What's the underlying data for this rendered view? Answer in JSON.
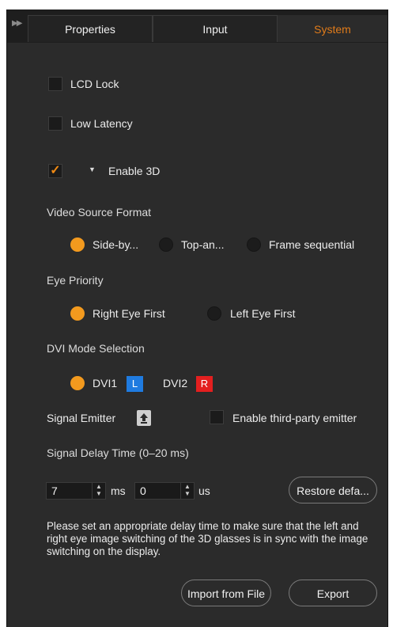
{
  "tabs": [
    {
      "label": "Properties",
      "active": false
    },
    {
      "label": "Input",
      "active": false
    },
    {
      "label": "System",
      "active": true
    }
  ],
  "colors": {
    "accent": "#f39a1e",
    "active_tab": "#e07b1a",
    "background": "#2b2b2b",
    "tag_left": "#1f7be0",
    "tag_right": "#e31f1f"
  },
  "options": {
    "lcd_lock": {
      "label": "LCD Lock",
      "checked": false
    },
    "low_latency": {
      "label": "Low Latency",
      "checked": false
    },
    "enable_3d": {
      "label": "Enable 3D",
      "checked": true,
      "check_glyph": "✓",
      "expand_glyph": "▼"
    }
  },
  "video_source_format": {
    "title": "Video Source Format",
    "options": [
      "Side-by...",
      "Top-an...",
      "Frame sequential"
    ],
    "selected": "Side-by..."
  },
  "eye_priority": {
    "title": "Eye Priority",
    "options": [
      "Right Eye First",
      "Left Eye First"
    ],
    "selected": "Right Eye First"
  },
  "dvi_mode": {
    "title": "DVI Mode Selection",
    "dvi1_label": "DVI1",
    "dvi1_tag": "L",
    "dvi2_label": "DVI2",
    "dvi2_tag": "R",
    "selected": "DVI1"
  },
  "signal_emitter": {
    "label": "Signal Emitter",
    "icon": "upload-icon",
    "third_party_label": "Enable third-party emitter",
    "third_party_checked": false
  },
  "signal_delay": {
    "title": "Signal Delay Time (0–20 ms)",
    "ms_value": "7",
    "ms_unit": "ms",
    "us_value": "0",
    "us_unit": "us",
    "restore_label": "Restore defa..."
  },
  "note": "Please set an appropriate delay time to make sure that the left and right eye image switching of the 3D glasses is in sync with the image switching on the display.",
  "footer": {
    "import_label": "Import from File",
    "export_label": "Export"
  }
}
